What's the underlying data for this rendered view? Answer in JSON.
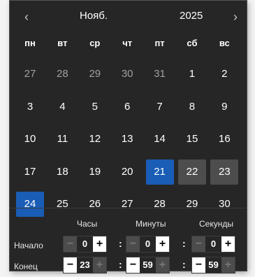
{
  "header": {
    "prev_icon": "‹",
    "next_icon": "›",
    "month": "Нояб.",
    "year": "2025"
  },
  "weekdays": [
    "пн",
    "вт",
    "ср",
    "чт",
    "пт",
    "сб",
    "вс"
  ],
  "days": [
    {
      "label": "27",
      "state": "other"
    },
    {
      "label": "28",
      "state": "other"
    },
    {
      "label": "29",
      "state": "other"
    },
    {
      "label": "30",
      "state": "other"
    },
    {
      "label": "31",
      "state": "other"
    },
    {
      "label": "1",
      "state": ""
    },
    {
      "label": "2",
      "state": ""
    },
    {
      "label": "3",
      "state": ""
    },
    {
      "label": "4",
      "state": ""
    },
    {
      "label": "5",
      "state": ""
    },
    {
      "label": "6",
      "state": ""
    },
    {
      "label": "7",
      "state": ""
    },
    {
      "label": "8",
      "state": ""
    },
    {
      "label": "9",
      "state": ""
    },
    {
      "label": "10",
      "state": ""
    },
    {
      "label": "11",
      "state": ""
    },
    {
      "label": "12",
      "state": ""
    },
    {
      "label": "13",
      "state": ""
    },
    {
      "label": "14",
      "state": ""
    },
    {
      "label": "15",
      "state": ""
    },
    {
      "label": "16",
      "state": ""
    },
    {
      "label": "17",
      "state": ""
    },
    {
      "label": "18",
      "state": ""
    },
    {
      "label": "19",
      "state": ""
    },
    {
      "label": "20",
      "state": ""
    },
    {
      "label": "21",
      "state": "sel"
    },
    {
      "label": "22",
      "state": "wkend"
    },
    {
      "label": "23",
      "state": "wkend"
    },
    {
      "label": "24",
      "state": "sel"
    },
    {
      "label": "25",
      "state": ""
    },
    {
      "label": "26",
      "state": ""
    },
    {
      "label": "27",
      "state": ""
    },
    {
      "label": "28",
      "state": ""
    },
    {
      "label": "29",
      "state": ""
    },
    {
      "label": "30",
      "state": ""
    }
  ],
  "time": {
    "col_hours": "Часы",
    "col_minutes": "Минуты",
    "col_seconds": "Секунды",
    "start_label": "Начало",
    "end_label": "Конец",
    "start": {
      "hours": "0",
      "minutes": "0",
      "seconds": "0"
    },
    "end": {
      "hours": "23",
      "minutes": "59",
      "seconds": "59"
    },
    "minus": "−",
    "plus": "+",
    "colon": ":"
  },
  "colors": {
    "background": "#262626",
    "selected": "#1a5db6",
    "highlight": "#4d4d4d"
  }
}
